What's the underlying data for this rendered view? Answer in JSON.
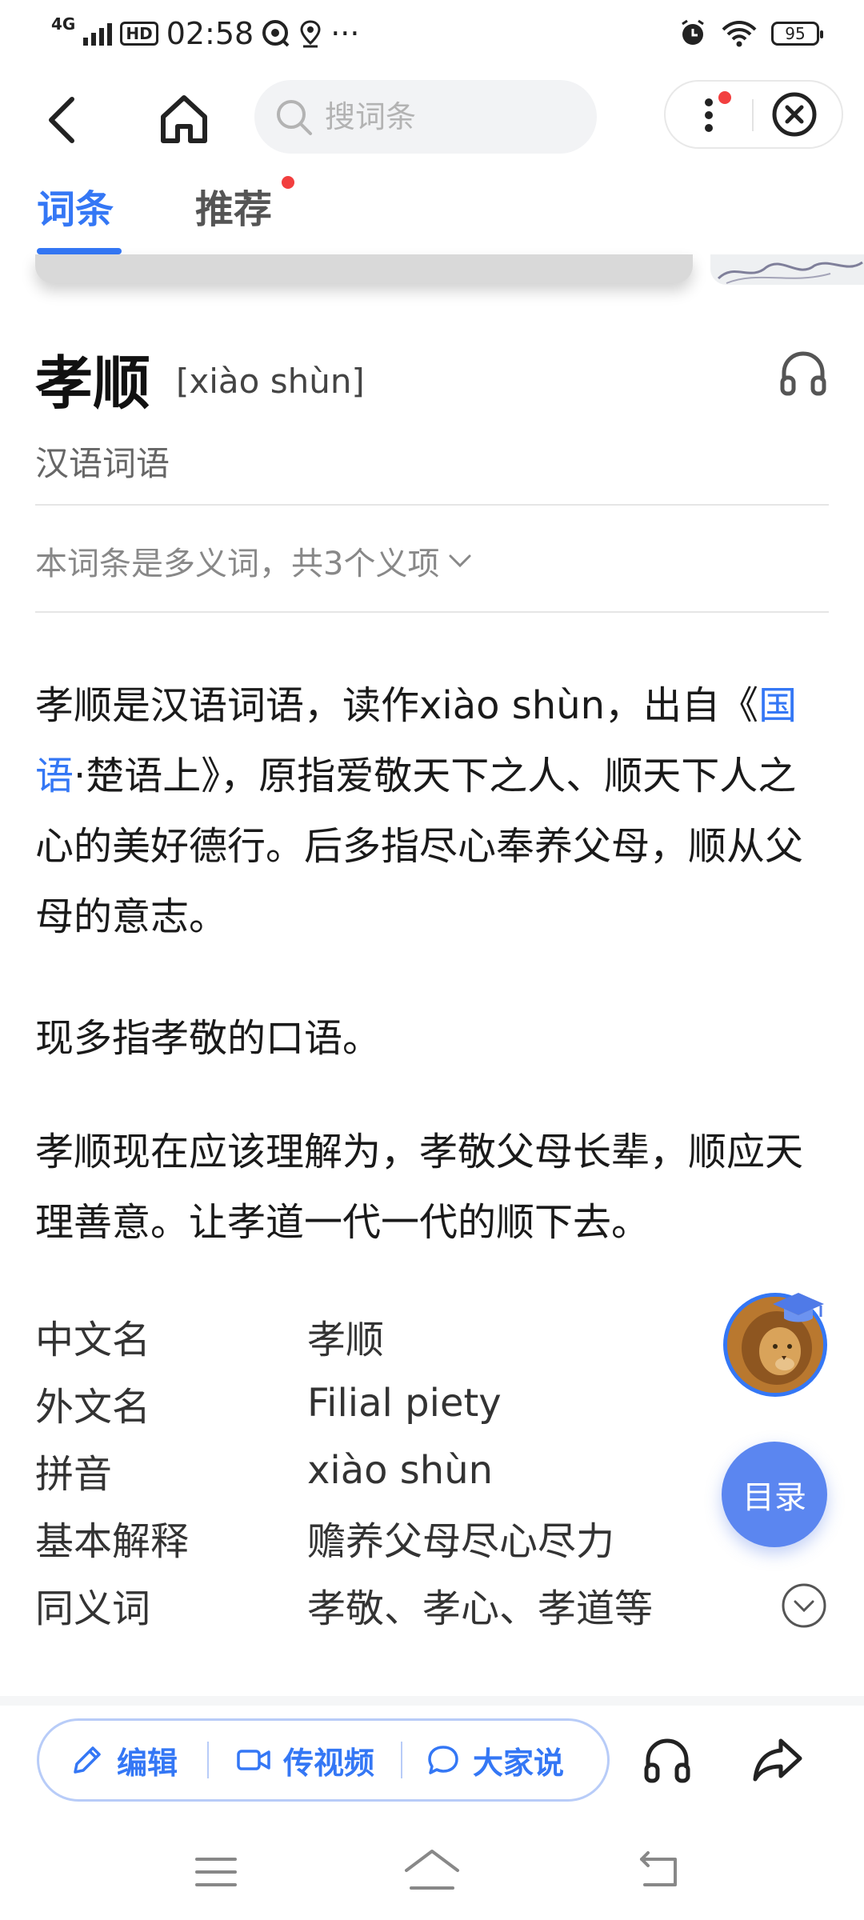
{
  "status_bar": {
    "network": "4G",
    "hd": "HD",
    "time": "02:58",
    "more": "···",
    "battery": "95",
    "icons": [
      "signal-icon",
      "hd-icon",
      "app-badge-icon",
      "location-icon",
      "alarm-icon",
      "wifi-icon",
      "battery-icon"
    ]
  },
  "nav": {
    "search_placeholder": "搜词条",
    "icons": [
      "back-icon",
      "home-icon",
      "search-icon",
      "more-icon",
      "close-icon"
    ]
  },
  "tabs": [
    {
      "label": "词条",
      "active": true
    },
    {
      "label": "推荐",
      "active": false,
      "has_dot": true
    }
  ],
  "entry": {
    "title": "孝顺",
    "pinyin": "[xiào shùn]",
    "category": "汉语词语",
    "polysemy_note": "本词条是多义词，共3个义项"
  },
  "paragraphs": {
    "p1_before_link": "孝顺是汉语词语，读作xiào shùn，出自《",
    "p1_link": "国语",
    "p1_after_link": "·楚语上》，原指爱敬天下之人、顺天下人之心的美好德行。后多指尽心奉养父母，顺从父母的意志。",
    "p2": "现多指孝敬的口语。",
    "p3": "孝顺现在应该理解为，孝敬父母长辈，顺应天理善意。让孝道一代一代的顺下去。"
  },
  "info_table": [
    {
      "key": "中文名",
      "value": "孝顺"
    },
    {
      "key": "外文名",
      "value": "Filial piety"
    },
    {
      "key": "拼音",
      "value": "xiào shùn"
    },
    {
      "key": "基本解释",
      "value": "赡养父母尽心尽力"
    },
    {
      "key": "同义词",
      "value": "孝敬、孝心、孝道等"
    }
  ],
  "floating": {
    "toc_label": "目录"
  },
  "bottom_bar": {
    "edit_label": "编辑",
    "video_label": "传视频",
    "discuss_label": "大家说"
  },
  "colors": {
    "accent": "#3477f5",
    "toc_button": "#5b86f0",
    "red_dot": "#f23f3f",
    "pill_border": "#b8ccf8"
  }
}
